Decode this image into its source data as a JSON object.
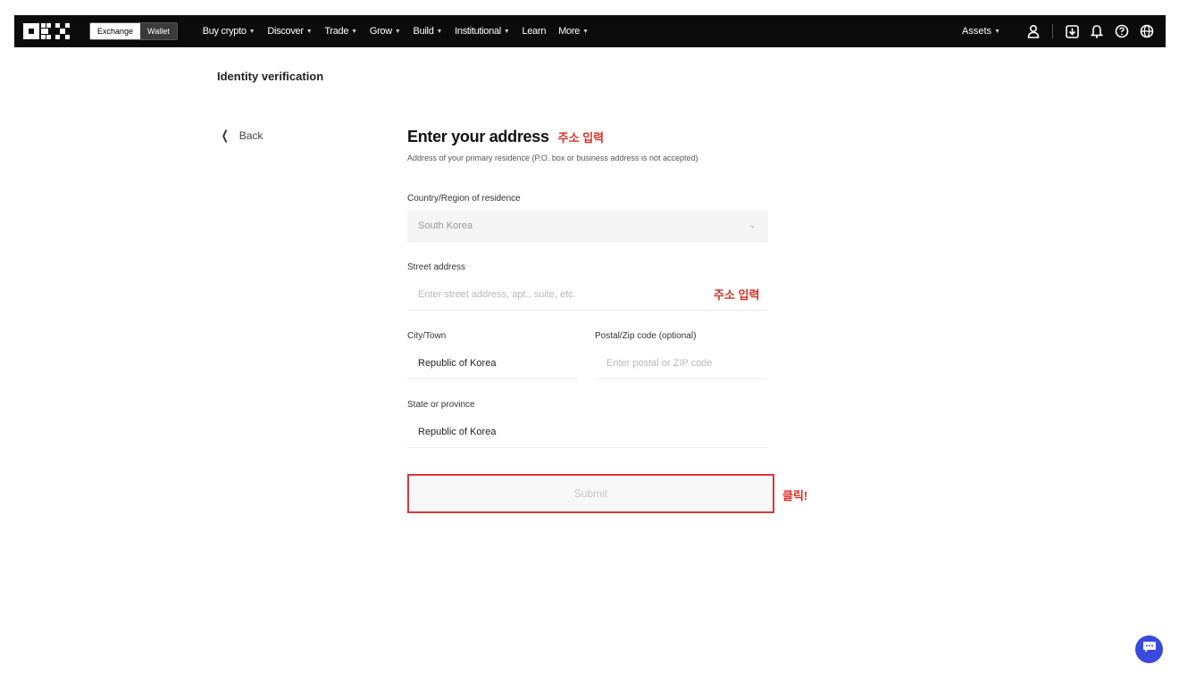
{
  "nav": {
    "exchange_label": "Exchange",
    "wallet_label": "Wallet",
    "items": [
      {
        "label": "Buy crypto",
        "has_dropdown": true
      },
      {
        "label": "Discover",
        "has_dropdown": true
      },
      {
        "label": "Trade",
        "has_dropdown": true
      },
      {
        "label": "Grow",
        "has_dropdown": true
      },
      {
        "label": "Build",
        "has_dropdown": true
      },
      {
        "label": "Institutional",
        "has_dropdown": true
      },
      {
        "label": "Learn",
        "has_dropdown": false
      },
      {
        "label": "More",
        "has_dropdown": true
      }
    ],
    "assets_label": "Assets",
    "icons": [
      "user-icon",
      "download-icon",
      "bell-icon",
      "help-icon",
      "globe-icon"
    ]
  },
  "page": {
    "title": "Identity verification",
    "back_label": "Back"
  },
  "form": {
    "heading": "Enter your address",
    "heading_annotation": "주소 입력",
    "subtitle": "Address of your primary residence (P.O. box or business address is not accepted)",
    "country_label": "Country/Region of residence",
    "country_value": "South Korea",
    "street_label": "Street address",
    "street_placeholder": "Enter street address, apt., suite, etc.",
    "street_annotation": "주소 입력",
    "city_label": "City/Town",
    "city_value": "Republic of Korea",
    "postal_label": "Postal/Zip code (optional)",
    "postal_placeholder": "Enter postal or ZIP code",
    "state_label": "State or province",
    "state_value": "Republic of Korea",
    "submit_label": "Submit",
    "submit_annotation": "클릭!"
  },
  "colors": {
    "topbar": "#0b0b0b",
    "annotation_red": "#d93025",
    "chat_button": "#3b49df"
  }
}
